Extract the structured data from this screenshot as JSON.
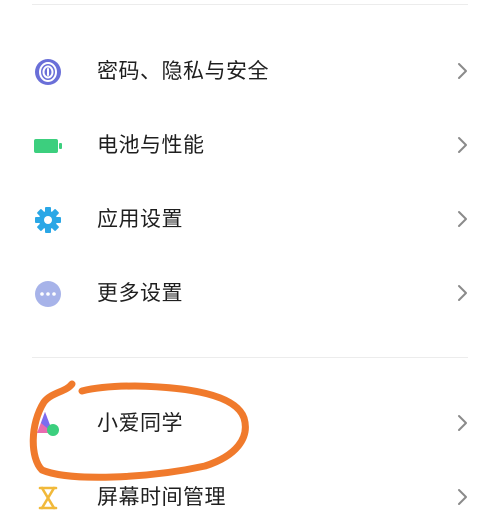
{
  "settings_list": {
    "items": [
      {
        "label": "密码、隐私与安全",
        "icon": "fingerprint-icon",
        "color": "#6a6fd8"
      },
      {
        "label": "电池与性能",
        "icon": "battery-icon",
        "color": "#3ccf7e"
      },
      {
        "label": "应用设置",
        "icon": "gear-icon",
        "color": "#2aa7e6"
      },
      {
        "label": "更多设置",
        "icon": "more-dots-icon",
        "color": "#a7b3e9"
      },
      {
        "label": "小爱同学",
        "icon": "xiaoai-icon",
        "color": "#7c6df0"
      },
      {
        "label": "屏幕时间管理",
        "icon": "hourglass-icon",
        "color": "#f1b93a"
      }
    ]
  },
  "annotation": {
    "color": "#f07a2c"
  }
}
